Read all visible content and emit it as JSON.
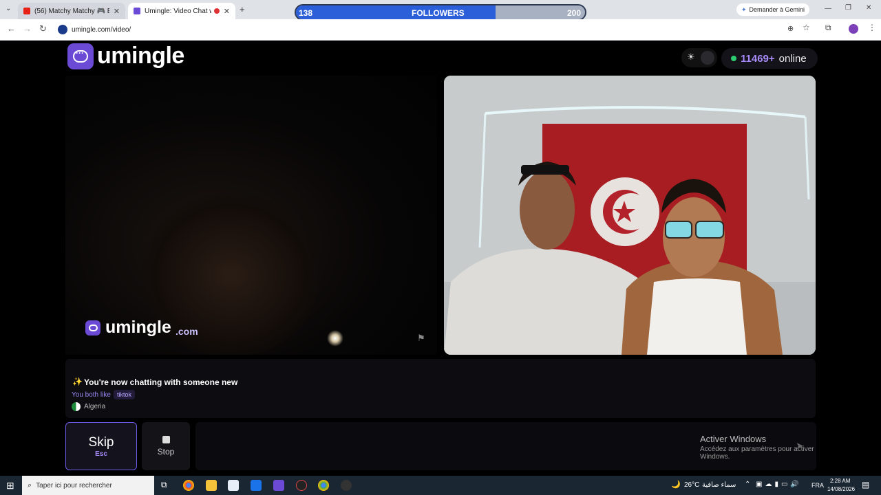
{
  "browser": {
    "tabs": [
      {
        "label": "(56) Matchy Matchy 🎮 Ep 93 \\",
        "close": "✕"
      },
      {
        "label": "Umingle: Video Chat with S",
        "close": "✕"
      }
    ],
    "new_tab": "+",
    "url": "umingle.com/video/",
    "gemini_button": "Demander à Gemini",
    "window_controls": [
      "—",
      "❐",
      "✕"
    ]
  },
  "followers_bar": {
    "current": "138",
    "label": "FOLLOWERS",
    "goal": "200",
    "progress": 0.69
  },
  "page": {
    "logo_text": "umingle",
    "online_count": "11469+",
    "online_label": "online",
    "watermark": {
      "main": "umingle",
      "suffix": ".com"
    },
    "chat": {
      "sparkle": "✨",
      "status": "You're now chatting with someone new",
      "common_label": "You both like",
      "common_tag": "tiktok",
      "country": "Algeria"
    },
    "buttons": {
      "skip_label": "Skip",
      "skip_hint": "Esc",
      "stop_label": "Stop"
    },
    "windows_overlay": {
      "title": "Activer Windows",
      "subtitle": "Accédez aux paramètres pour activer Windows."
    }
  },
  "taskbar": {
    "search_placeholder": "Taper ici pour rechercher",
    "weather": "26°C",
    "weather_desc": "سماء صافية",
    "lang": "FRA",
    "time": "2:28 AM",
    "date": "14/08/2026"
  },
  "colors": {
    "accent": "#6b4bd6",
    "online": "#2ecc71",
    "followers_fill": "#2b5fd9"
  }
}
